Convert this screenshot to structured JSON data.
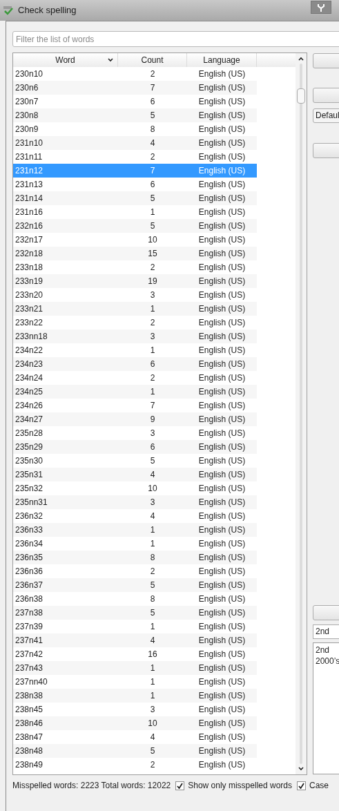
{
  "window": {
    "title": "Check spelling"
  },
  "filter": {
    "placeholder": "Filter the list of words"
  },
  "table": {
    "columns": [
      {
        "label": "Word",
        "sorted": true
      },
      {
        "label": "Count",
        "sorted": false
      },
      {
        "label": "Language",
        "sorted": false
      }
    ],
    "rows": [
      {
        "word": "230n10",
        "count": "2",
        "language": "English (US)",
        "selected": false
      },
      {
        "word": "230n6",
        "count": "7",
        "language": "English (US)",
        "selected": false
      },
      {
        "word": "230n7",
        "count": "6",
        "language": "English (US)",
        "selected": false
      },
      {
        "word": "230n8",
        "count": "5",
        "language": "English (US)",
        "selected": false
      },
      {
        "word": "230n9",
        "count": "8",
        "language": "English (US)",
        "selected": false
      },
      {
        "word": "231n10",
        "count": "4",
        "language": "English (US)",
        "selected": false
      },
      {
        "word": "231n11",
        "count": "2",
        "language": "English (US)",
        "selected": false
      },
      {
        "word": "231n12",
        "count": "7",
        "language": "English (US)",
        "selected": true
      },
      {
        "word": "231n13",
        "count": "6",
        "language": "English (US)",
        "selected": false
      },
      {
        "word": "231n14",
        "count": "5",
        "language": "English (US)",
        "selected": false
      },
      {
        "word": "231n16",
        "count": "1",
        "language": "English (US)",
        "selected": false
      },
      {
        "word": "232n16",
        "count": "5",
        "language": "English (US)",
        "selected": false
      },
      {
        "word": "232n17",
        "count": "10",
        "language": "English (US)",
        "selected": false
      },
      {
        "word": "232n18",
        "count": "15",
        "language": "English (US)",
        "selected": false
      },
      {
        "word": "233n18",
        "count": "2",
        "language": "English (US)",
        "selected": false
      },
      {
        "word": "233n19",
        "count": "19",
        "language": "English (US)",
        "selected": false
      },
      {
        "word": "233n20",
        "count": "3",
        "language": "English (US)",
        "selected": false
      },
      {
        "word": "233n21",
        "count": "1",
        "language": "English (US)",
        "selected": false
      },
      {
        "word": "233n22",
        "count": "2",
        "language": "English (US)",
        "selected": false
      },
      {
        "word": "233nn18",
        "count": "3",
        "language": "English (US)",
        "selected": false
      },
      {
        "word": "234n22",
        "count": "1",
        "language": "English (US)",
        "selected": false
      },
      {
        "word": "234n23",
        "count": "6",
        "language": "English (US)",
        "selected": false
      },
      {
        "word": "234n24",
        "count": "2",
        "language": "English (US)",
        "selected": false
      },
      {
        "word": "234n25",
        "count": "1",
        "language": "English (US)",
        "selected": false
      },
      {
        "word": "234n26",
        "count": "7",
        "language": "English (US)",
        "selected": false
      },
      {
        "word": "234n27",
        "count": "9",
        "language": "English (US)",
        "selected": false
      },
      {
        "word": "235n28",
        "count": "3",
        "language": "English (US)",
        "selected": false
      },
      {
        "word": "235n29",
        "count": "6",
        "language": "English (US)",
        "selected": false
      },
      {
        "word": "235n30",
        "count": "5",
        "language": "English (US)",
        "selected": false
      },
      {
        "word": "235n31",
        "count": "4",
        "language": "English (US)",
        "selected": false
      },
      {
        "word": "235n32",
        "count": "10",
        "language": "English (US)",
        "selected": false
      },
      {
        "word": "235nn31",
        "count": "3",
        "language": "English (US)",
        "selected": false
      },
      {
        "word": "236n32",
        "count": "4",
        "language": "English (US)",
        "selected": false
      },
      {
        "word": "236n33",
        "count": "1",
        "language": "English (US)",
        "selected": false
      },
      {
        "word": "236n34",
        "count": "1",
        "language": "English (US)",
        "selected": false
      },
      {
        "word": "236n35",
        "count": "8",
        "language": "English (US)",
        "selected": false
      },
      {
        "word": "236n36",
        "count": "2",
        "language": "English (US)",
        "selected": false
      },
      {
        "word": "236n37",
        "count": "5",
        "language": "English (US)",
        "selected": false
      },
      {
        "word": "236n38",
        "count": "8",
        "language": "English (US)",
        "selected": false
      },
      {
        "word": "237n38",
        "count": "5",
        "language": "English (US)",
        "selected": false
      },
      {
        "word": "237n39",
        "count": "1",
        "language": "English (US)",
        "selected": false
      },
      {
        "word": "237n41",
        "count": "4",
        "language": "English (US)",
        "selected": false
      },
      {
        "word": "237n42",
        "count": "16",
        "language": "English (US)",
        "selected": false
      },
      {
        "word": "237n43",
        "count": "1",
        "language": "English (US)",
        "selected": false
      },
      {
        "word": "237nn40",
        "count": "1",
        "language": "English (US)",
        "selected": false
      },
      {
        "word": "238n38",
        "count": "1",
        "language": "English (US)",
        "selected": false
      },
      {
        "word": "238n45",
        "count": "3",
        "language": "English (US)",
        "selected": false
      },
      {
        "word": "238n46",
        "count": "10",
        "language": "English (US)",
        "selected": false
      },
      {
        "word": "238n47",
        "count": "4",
        "language": "English (US)",
        "selected": false
      },
      {
        "word": "238n48",
        "count": "5",
        "language": "English (US)",
        "selected": false
      },
      {
        "word": "238n49",
        "count": "2",
        "language": "English (US)",
        "selected": false
      }
    ]
  },
  "side": {
    "dictionary": "Defaul",
    "replacement": "2nd",
    "suggestions": [
      "2nd",
      "2000’s"
    ]
  },
  "status": {
    "summary": "Misspelled words: 2223 Total words: 12022",
    "options": [
      {
        "label": "Show only misspelled words",
        "checked": true
      },
      {
        "label": "Case",
        "checked": true
      }
    ]
  }
}
